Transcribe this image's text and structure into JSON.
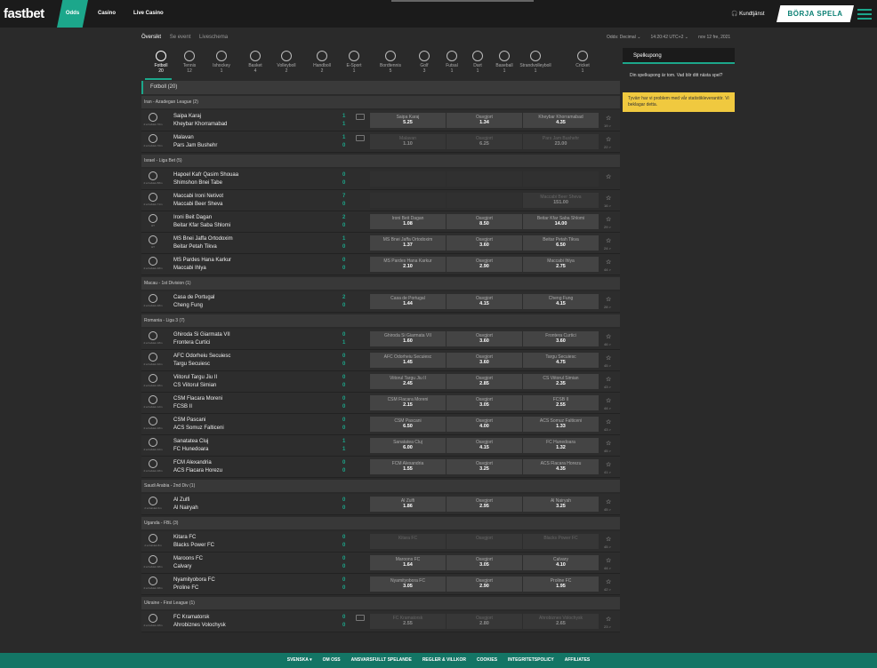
{
  "header": {
    "logo": "fastbet",
    "nav": [
      "Odds",
      "Casino",
      "Live Casino"
    ],
    "kundtjanst": "Kundtjänst",
    "cta": "BÖRJA SPELA"
  },
  "breadcrumb": [
    "Översikt",
    "Se event",
    "Liveschema"
  ],
  "meta": {
    "odds_label": "Odds:",
    "odds_format": "Decimal",
    "time": "14:20:42",
    "tz": "UTC+2",
    "date": "nov 12 fre, 2021"
  },
  "sports": [
    {
      "name": "Fotboll",
      "count": "20"
    },
    {
      "name": "Tennis",
      "count": "12"
    },
    {
      "name": "Ishockey",
      "count": "1"
    },
    {
      "name": "Basket",
      "count": "4"
    },
    {
      "name": "Volleyboll",
      "count": "2"
    },
    {
      "name": "Handboll",
      "count": "2"
    },
    {
      "name": "E-Sport",
      "count": "1"
    },
    {
      "name": "Bordtennis",
      "count": "5"
    },
    {
      "name": "Golf",
      "count": "3"
    },
    {
      "name": "Futsal",
      "count": "1"
    },
    {
      "name": "Dart",
      "count": "1"
    },
    {
      "name": "Baseball",
      "count": "1"
    },
    {
      "name": "Strandvolleyboll",
      "count": "1"
    },
    {
      "name": "Cricket",
      "count": "1"
    }
  ],
  "section_title": "Fotboll (20)",
  "leagues": [
    {
      "name": "Iran - Azadegan League (2)",
      "matches": [
        {
          "time": "2:a halvlek 70m",
          "t1": "Saipa Karaj",
          "t2": "Kheybar Khorramabad",
          "s1": "1",
          "s2": "1",
          "tv": true,
          "odds": [
            [
              "Saipa Karaj",
              "5.25"
            ],
            [
              "Oavgjort",
              "1.34"
            ],
            [
              "Kheybar Khorramabad",
              "4.35"
            ]
          ],
          "dim": false,
          "count": "19 >"
        },
        {
          "time": "2:a halvlek 70m",
          "t1": "Malavan",
          "t2": "Pars Jam Bushehr",
          "s1": "1",
          "s2": "0",
          "tv": true,
          "odds": [
            [
              "Malavan",
              "1.10"
            ],
            [
              "Oavgjort",
              "6.25"
            ],
            [
              "Pars Jam Bushehr",
              "23.00"
            ]
          ],
          "dim": true,
          "count": "22 >"
        }
      ]
    },
    {
      "name": "Israel - Liga Bet (5)",
      "matches": [
        {
          "time": "2:a halvlek 88m",
          "t1": "Hapoel Kafr Qasim Shouaa",
          "t2": "Shimshon Bnei Tabe",
          "s1": "0",
          "s2": "0",
          "tv": false,
          "odds": null,
          "dim": false,
          "count": ""
        },
        {
          "time": "2:a halvlek 71m",
          "t1": "Maccabi Ironi Netivot",
          "t2": "Maccabi Beer Sheva",
          "s1": "7",
          "s2": "0",
          "tv": false,
          "odds": [
            null,
            null,
            [
              "Maccabi Beer Sheva",
              "151.00"
            ]
          ],
          "dim": true,
          "count": "16 >"
        },
        {
          "time": "HT",
          "t1": "Ironi Beit Dagan",
          "t2": "Beitar Kfar Saba Shlomi",
          "s1": "2",
          "s2": "0",
          "tv": false,
          "odds": [
            [
              "Ironi Beit Dagan",
              "1.08"
            ],
            [
              "Oavgjort",
              "8.50"
            ],
            [
              "Beitar Kfar Saba Shlomi",
              "14.00"
            ]
          ],
          "dim": false,
          "count": "29 >"
        },
        {
          "time": "HT",
          "t1": "MS Bnei Jaffa Ortodoxim",
          "t2": "Beitar Petah Tikva",
          "s1": "1",
          "s2": "0",
          "tv": false,
          "odds": [
            [
              "MS Bnei Jaffa Ortodoxim",
              "1.37"
            ],
            [
              "Oavgjort",
              "3.60"
            ],
            [
              "Beitar Petah Tikva",
              "6.50"
            ]
          ],
          "dim": false,
          "count": "24 >"
        },
        {
          "time": "2:a halvlek 48m",
          "t1": "MS Pardes Hana Karkur",
          "t2": "Maccabi Ihlya",
          "s1": "0",
          "s2": "0",
          "tv": false,
          "odds": [
            [
              "MS Pardes Hana Karkur",
              "2.10"
            ],
            [
              "Oavgjort",
              "2.90"
            ],
            [
              "Maccabi Ihlya",
              "2.75"
            ]
          ],
          "dim": false,
          "count": "44 >"
        }
      ]
    },
    {
      "name": "Macau - 1st Division (1)",
      "matches": [
        {
          "time": "2:a halvlek 48m",
          "t1": "Casa de Portugal",
          "t2": "Cheng Fung",
          "s1": "2",
          "s2": "0",
          "tv": false,
          "odds": [
            [
              "Casa de Portugal",
              "1.44"
            ],
            [
              "Oavgjort",
              "4.15"
            ],
            [
              "Cheng Fung",
              "4.15"
            ]
          ],
          "dim": false,
          "count": "28 >"
        }
      ]
    },
    {
      "name": "Romania - Liga 3 (7)",
      "matches": [
        {
          "time": "2:a halvlek 18m",
          "t1": "Ghiroda Si Giarmata VII",
          "t2": "Frontera Curtici",
          "s1": "0",
          "s2": "1",
          "tv": false,
          "odds": [
            [
              "Ghiroda Si Giarmata VII",
              "1.60"
            ],
            [
              "Oavgjort",
              "3.60"
            ],
            [
              "Frontera Curtici",
              "3.60"
            ]
          ],
          "dim": false,
          "count": "46 >"
        },
        {
          "time": "2:a halvlek 32m",
          "t1": "AFC Odorheiu Secuiesc",
          "t2": "Targu Secuiesc",
          "s1": "0",
          "s2": "0",
          "tv": false,
          "odds": [
            [
              "AFC Odorheiu Secuiesc",
              "1.45"
            ],
            [
              "Oavgjort",
              "3.60"
            ],
            [
              "Targu Secuiesc",
              "4.75"
            ]
          ],
          "dim": false,
          "count": "45 >"
        },
        {
          "time": "2:a halvlek 28m",
          "t1": "Viitorul Targu Jiu II",
          "t2": "CS Viitorul Simian",
          "s1": "0",
          "s2": "0",
          "tv": false,
          "odds": [
            [
              "Viitorul Targu Jiu II",
              "2.45"
            ],
            [
              "Oavgjort",
              "2.85"
            ],
            [
              "CS Viitorul Simian",
              "2.35"
            ]
          ],
          "dim": false,
          "count": "43 >"
        },
        {
          "time": "2:a halvlek 12m",
          "t1": "CSM Flacara Moreni",
          "t2": "FCSB II",
          "s1": "0",
          "s2": "0",
          "tv": false,
          "odds": [
            [
              "CSM Flacara Moreni",
              "2.15"
            ],
            [
              "Oavgjort",
              "3.05"
            ],
            [
              "FCSB II",
              "2.55"
            ]
          ],
          "dim": false,
          "count": "44 >"
        },
        {
          "time": "2:a halvlek 28m",
          "t1": "CSM Pascani",
          "t2": "ACS Somuz Falticeni",
          "s1": "0",
          "s2": "0",
          "tv": false,
          "odds": [
            [
              "CSM Pascani",
              "6.50"
            ],
            [
              "Oavgjort",
              "4.00"
            ],
            [
              "ACS Somuz Falticeni",
              "1.33"
            ]
          ],
          "dim": false,
          "count": "43 >"
        },
        {
          "time": "2:a halvlek 22m",
          "t1": "Sanatatea Cluj",
          "t2": "FC Hunedoara",
          "s1": "1",
          "s2": "1",
          "tv": false,
          "odds": [
            [
              "Sanatatea Cluj",
              "6.00"
            ],
            [
              "Oavgjort",
              "4.15"
            ],
            [
              "FC Hunedoara",
              "1.32"
            ]
          ],
          "dim": false,
          "count": "45 >"
        },
        {
          "time": "2:a halvlek 28m",
          "t1": "FCM Alexandria",
          "t2": "ACS Flacara Horezu",
          "s1": "0",
          "s2": "0",
          "tv": false,
          "odds": [
            [
              "FCM Alexandria",
              "1.55"
            ],
            [
              "Oavgjort",
              "3.25"
            ],
            [
              "ACS Flacara Horezu",
              "4.35"
            ]
          ],
          "dim": false,
          "count": "41 >"
        }
      ]
    },
    {
      "name": "Saudi Arabia - 2nd Div (1)",
      "matches": [
        {
          "time": "2:a halvlek 6m",
          "t1": "Al Zulfi",
          "t2": "Al Nairyah",
          "s1": "0",
          "s2": "0",
          "tv": false,
          "odds": [
            [
              "Al Zulfi",
              "1.86"
            ],
            [
              "Oavgjort",
              "2.95"
            ],
            [
              "Al Nairyah",
              "3.25"
            ]
          ],
          "dim": false,
          "count": "45 >"
        }
      ]
    },
    {
      "name": "Uganda - FBL (3)",
      "matches": [
        {
          "time": "2:a halvlek 8m",
          "t1": "Kitara FC",
          "t2": "Blacks Power FC",
          "s1": "0",
          "s2": "0",
          "tv": false,
          "odds": [
            [
              "Kitara FC",
              ""
            ],
            [
              "Oavgjort",
              ""
            ],
            [
              "Blacks Power FC",
              ""
            ]
          ],
          "dim": true,
          "count": "45 >"
        },
        {
          "time": "2:a halvlek 38m",
          "t1": "Maroons FC",
          "t2": "Calvary",
          "s1": "0",
          "s2": "0",
          "tv": false,
          "odds": [
            [
              "Maroons FC",
              "1.64"
            ],
            [
              "Oavgjort",
              "3.05"
            ],
            [
              "Calvary",
              "4.10"
            ]
          ],
          "dim": false,
          "count": "44 >"
        },
        {
          "time": "2:a halvlek 38m",
          "t1": "Nyamityobora FC",
          "t2": "Proline FC",
          "s1": "0",
          "s2": "0",
          "tv": false,
          "odds": [
            [
              "Nyamityobora FC",
              "3.05"
            ],
            [
              "Oavgjort",
              "2.90"
            ],
            [
              "Proline FC",
              "1.95"
            ]
          ],
          "dim": false,
          "count": "42 >"
        }
      ]
    },
    {
      "name": "Ukraine - First League (1)",
      "matches": [
        {
          "time": "2:a halvlek 48m",
          "t1": "FC Kramatorsk",
          "t2": "Ahrobiznes Volochysk",
          "s1": "0",
          "s2": "0",
          "tv": true,
          "odds": [
            [
              "FC Kramatorsk",
              "2.55"
            ],
            [
              "Oavgjort",
              "2.80"
            ],
            [
              "Ahrobiznes Volochysk",
              "2.65"
            ]
          ],
          "dim": true,
          "count": "23 >"
        }
      ]
    }
  ],
  "slip": {
    "tab": "Spelkupong",
    "empty": "Din spelkupong är tom. Vad blir ditt nästa spel?",
    "warning": "Tyvärr har vi problem med vår statistikleverantör. Vi beklagar detta."
  },
  "footer": [
    "SVENSKA ▾",
    "OM OSS",
    "ANSVARSFULLT SPELANDE",
    "REGLER & VILLKOR",
    "COOKIES",
    "INTEGRITETSPOLICY",
    "AFFILIATES"
  ]
}
